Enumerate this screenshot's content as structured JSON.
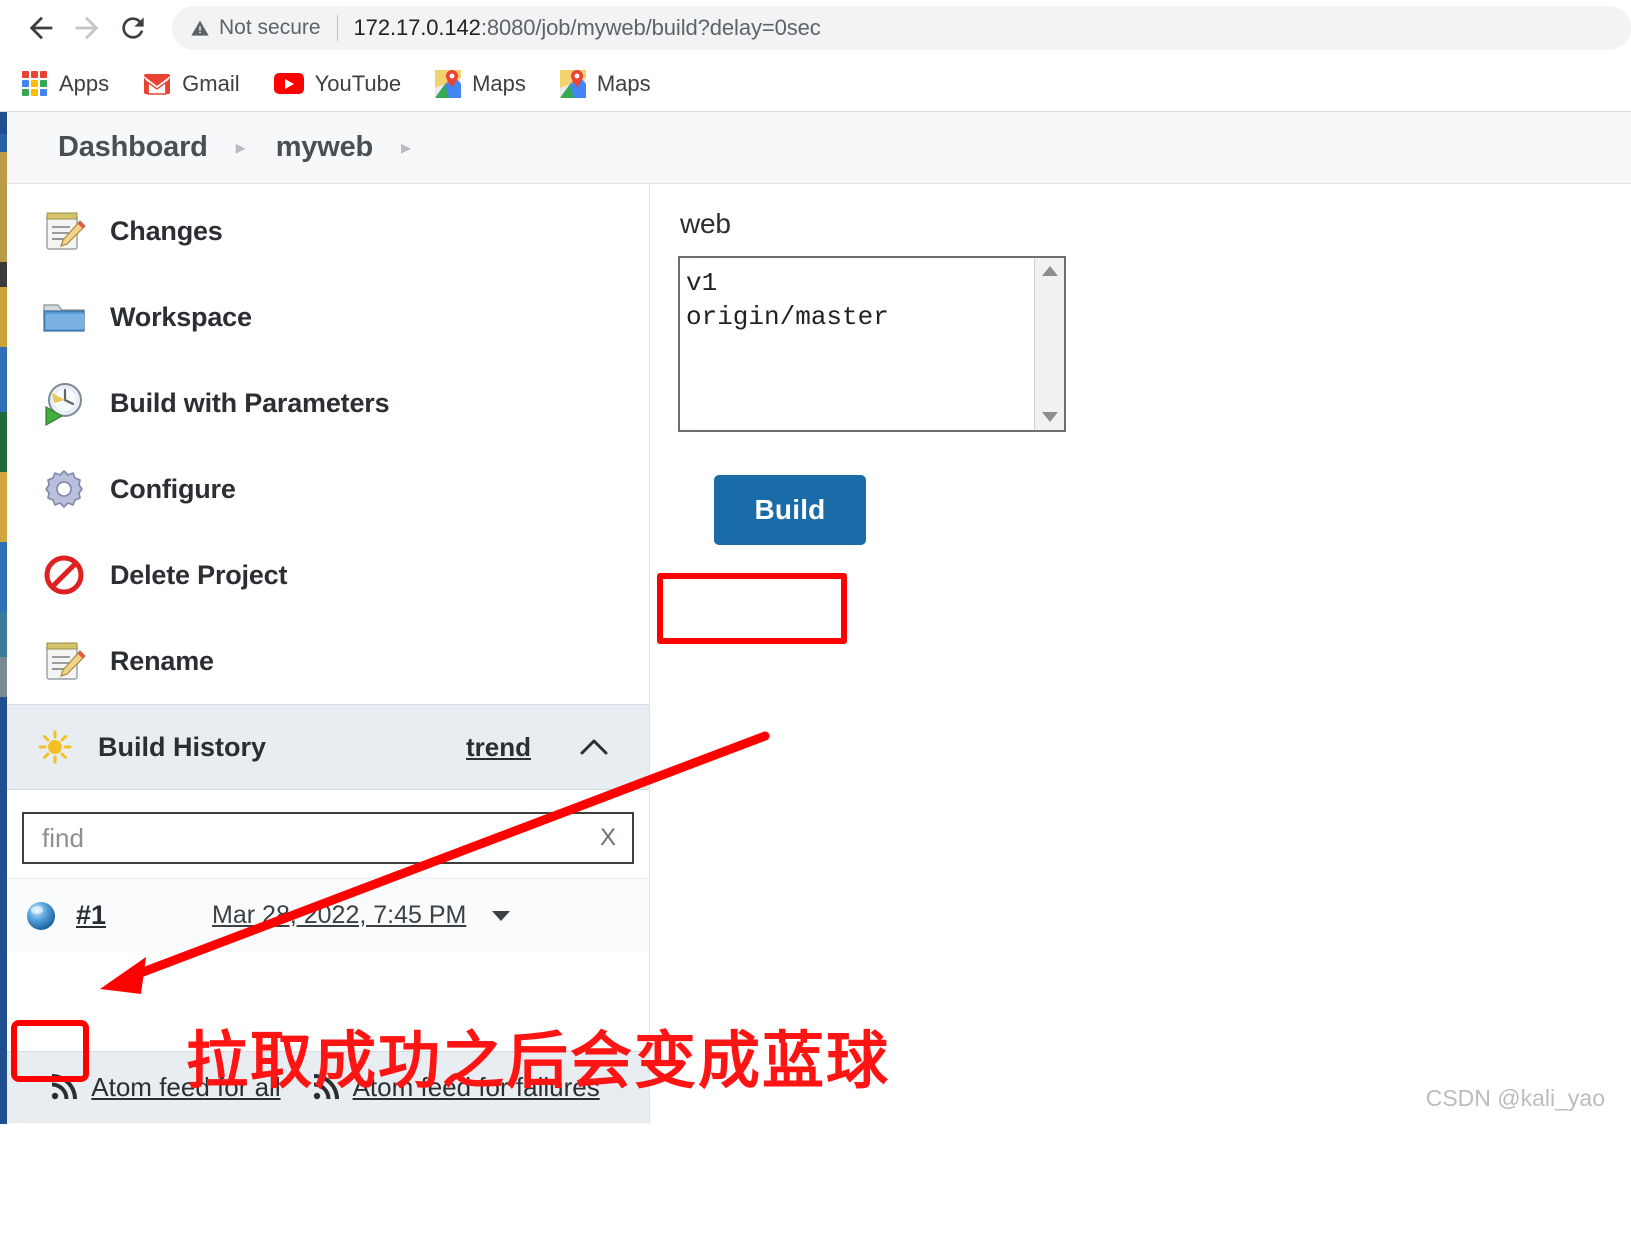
{
  "browser": {
    "back_icon": "back-arrow-icon",
    "forward_icon": "forward-arrow-icon",
    "reload_icon": "reload-icon",
    "security_label": "Not secure",
    "url": "172.17.0.142:8080/job/myweb/build?delay=0sec",
    "url_host": "172.17.0.142",
    "url_path": ":8080/job/myweb/build?delay=0sec",
    "bookmarks": [
      {
        "label": "Apps",
        "icon": "apps-grid-icon"
      },
      {
        "label": "Gmail",
        "icon": "gmail-icon"
      },
      {
        "label": "YouTube",
        "icon": "youtube-icon"
      },
      {
        "label": "Maps",
        "icon": "maps-pin-icon"
      },
      {
        "label": "Maps",
        "icon": "maps-pin-icon"
      }
    ]
  },
  "breadcrumb": {
    "items": [
      "Dashboard",
      "myweb"
    ],
    "separator": "▸"
  },
  "sidebar": {
    "tasks": [
      {
        "label": "Changes",
        "icon": "notepad-pencil-icon"
      },
      {
        "label": "Workspace",
        "icon": "folder-icon"
      },
      {
        "label": "Build with Parameters",
        "icon": "clock-play-icon"
      },
      {
        "label": "Configure",
        "icon": "gear-icon"
      },
      {
        "label": "Delete Project",
        "icon": "no-entry-icon"
      },
      {
        "label": "Rename",
        "icon": "notepad-pencil-icon"
      }
    ],
    "build_history": {
      "title": "Build History",
      "icon": "sun-icon",
      "trend_label": "trend",
      "collapse_icon": "chevron-up-icon",
      "find_placeholder": "find",
      "find_value": "",
      "find_clear_label": "X",
      "builds": [
        {
          "number": "#1",
          "date": "Mar 28, 2022, 7:45 PM",
          "status_icon": "blue-ball-icon"
        }
      ]
    },
    "feeds": [
      {
        "label": "Atom feed for all",
        "icon": "rss-icon"
      },
      {
        "label": "Atom feed for failures",
        "icon": "rss-icon"
      }
    ]
  },
  "main": {
    "parameter_name": "web",
    "listbox_options": [
      "v1",
      "origin/master"
    ],
    "listbox_scroll_up_icon": "scroll-up-arrow-icon",
    "listbox_scroll_down_icon": "scroll-down-arrow-icon",
    "build_button_label": "Build"
  },
  "annotations": {
    "note_text": "拉取成功之后会变成蓝球",
    "color": "#ff0000",
    "arrow_icon": "red-arrow-icon",
    "highlight_build_button": true,
    "highlight_build_number": true
  },
  "watermark": "CSDN @kali_yao"
}
